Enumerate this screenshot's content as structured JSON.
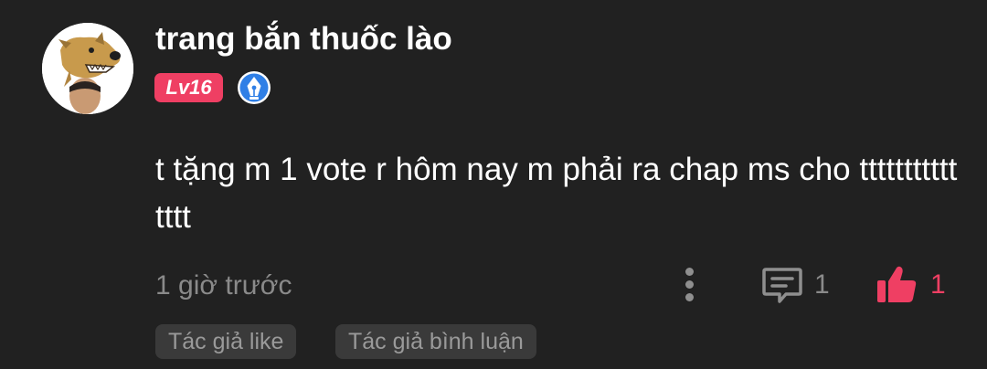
{
  "comment": {
    "username": "trang bắn thuốc lào",
    "level_badge": "Lv16",
    "author_badge_icon": "blue-pen-nib-badge",
    "text": "t tặng m 1 vote r hôm nay m phải ra chap ms cho ttttttttttttttt",
    "timestamp": "1 giờ trước",
    "reply_count": "1",
    "like_count": "1",
    "tags": [
      "Tác giả like",
      "Tác giả bình luận"
    ]
  },
  "colors": {
    "background": "#212121",
    "username": "#ffffff",
    "level_badge": "#ef3f63",
    "like_accent": "#ef3f63",
    "secondary_text": "#8a8a8a",
    "tag_background": "#3a3a3a"
  },
  "icons": {
    "more": "vertical-dots-icon",
    "reply": "comment-bubble-icon",
    "like": "thumbs-up-icon"
  }
}
